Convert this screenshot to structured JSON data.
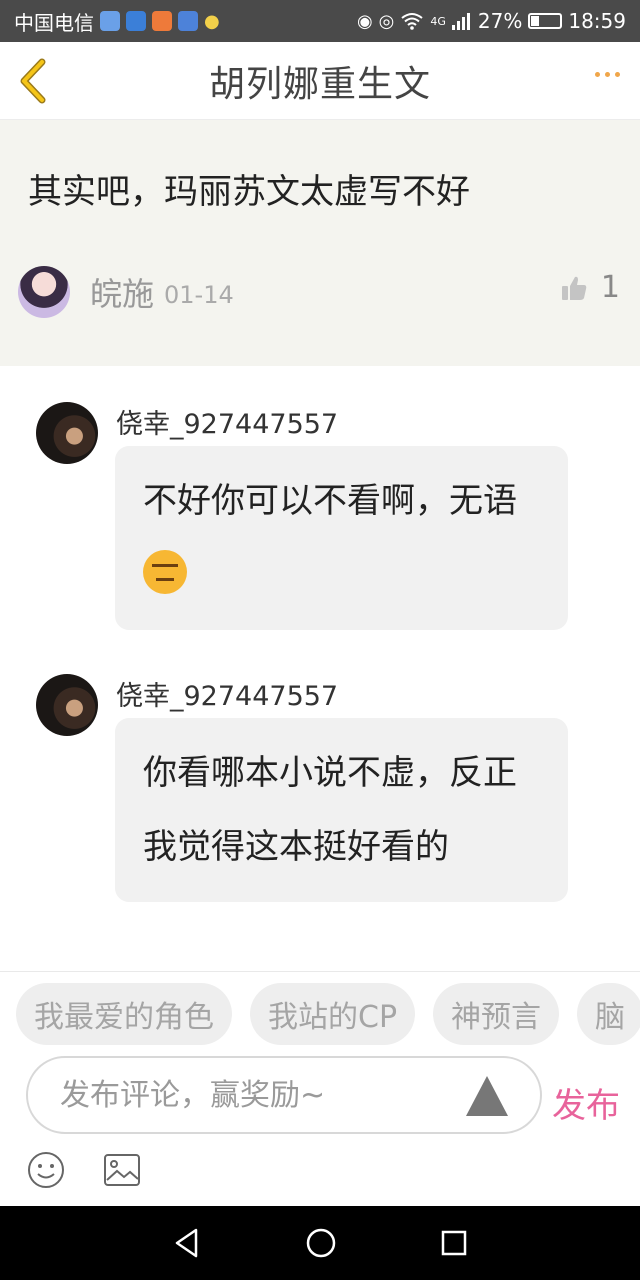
{
  "status_bar": {
    "carrier": "中国电信",
    "network": "4G",
    "battery": "27%",
    "battery_level": 0.27,
    "time": "18:59"
  },
  "header": {
    "title": "胡列娜重生文"
  },
  "post": {
    "text": "其实吧，玛丽苏文太虚写不好",
    "author": "皖施",
    "date": "01-14",
    "like_count": "1"
  },
  "replies": [
    {
      "username": "侥幸_927447557",
      "text": "不好你可以不看啊，无语",
      "emoji": "expressionless-face"
    },
    {
      "username": "侥幸_927447557",
      "text": "你看哪本小说不虚，反正我觉得这本挺好看的"
    }
  ],
  "tags": [
    "我最爱的角色",
    "我站的CP",
    "神预言",
    "脑"
  ],
  "comment": {
    "placeholder": "发布评论，赢奖励~",
    "value": "",
    "publish_label": "发布"
  },
  "colors": {
    "accent": "#f0a64a",
    "publish": "#e8639b",
    "post_bg": "#f4f4ef",
    "bubble_bg": "#f1f1f1"
  }
}
